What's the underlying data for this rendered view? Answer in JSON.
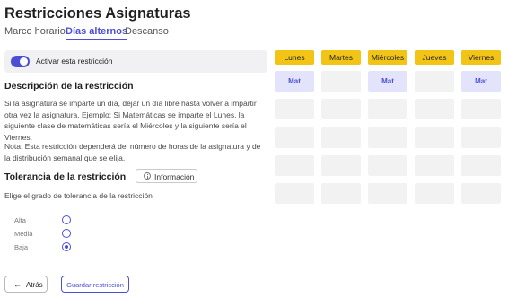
{
  "page": {
    "title": "Restricciones Asignaturas"
  },
  "tabs": [
    {
      "label": "Marco horario",
      "active": false
    },
    {
      "label": "Días alternos",
      "active": true
    },
    {
      "label": "Descanso",
      "active": false
    }
  ],
  "toggle": {
    "label": "Activar esta restricción",
    "enabled": true
  },
  "description": {
    "title": "Descripción de la restricción",
    "text": "Si la asignatura se imparte un día, dejar un día libre hasta volver a impartir otra vez la asignatura. Ejemplo: Si Matemáticas se imparte el Lunes, la siguiente clase de matemáticas sería el Miércoles y la siguiente sería el Viernes.",
    "note": "Nota: Esta restricción dependerá del número de horas de la asignatura y de la distribución semanal que se elija."
  },
  "tolerance": {
    "title": "Tolerancia de la restricción",
    "info_label": "Información",
    "hint": "Elige el grado de tolerancia de la restricción",
    "options": [
      {
        "label": "Alta",
        "checked": false
      },
      {
        "label": "Media",
        "checked": false
      },
      {
        "label": "Baja",
        "checked": true
      }
    ]
  },
  "actions": {
    "back_label": "Atrás",
    "save_label": "Guardar restricción"
  },
  "schedule": {
    "days": [
      "Lunes",
      "Martes",
      "Miércoles",
      "Jueves",
      "Viernes"
    ],
    "rows": [
      [
        "Mat",
        "",
        "Mat",
        "",
        "Mat"
      ],
      [
        "",
        "",
        "",
        "",
        ""
      ],
      [
        "",
        "",
        "",
        "",
        ""
      ],
      [
        "",
        "",
        "",
        "",
        ""
      ],
      [
        "",
        "",
        "",
        "",
        ""
      ]
    ]
  },
  "colors": {
    "accent": "#4b4fd6",
    "day_header": "#f2c416",
    "cell": "#f2f2f3",
    "cell_highlight": "#e3e4fb"
  }
}
